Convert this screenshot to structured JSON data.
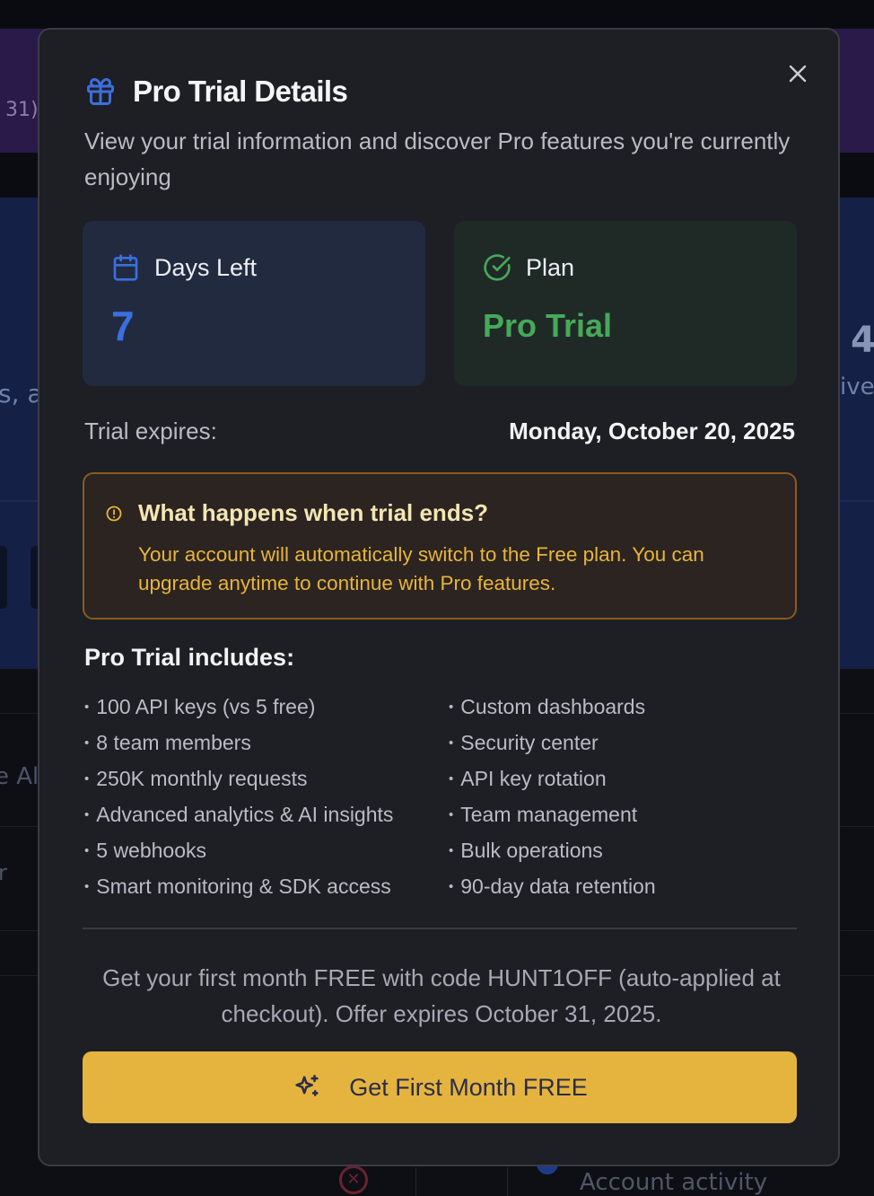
{
  "background": {
    "banner_text": "31)",
    "hero_left_text": "s, a",
    "hero_number": "4",
    "hero_right_text": "ive",
    "lower_text_1": "e Ale",
    "lower_text_2": "r",
    "bottom_text": "Account activity"
  },
  "modal": {
    "title": "Pro Trial Details",
    "subtitle": "View your trial information and discover Pro features you're currently enjoying",
    "days_card": {
      "label": "Days Left",
      "value": "7"
    },
    "plan_card": {
      "label": "Plan",
      "value": "Pro Trial"
    },
    "expires": {
      "label": "Trial expires:",
      "value": "Monday, October 20, 2025"
    },
    "warning": {
      "title": "What happens when trial ends?",
      "text": "Your account will automatically switch to the Free plan. You can upgrade anytime to continue with Pro features."
    },
    "includes": {
      "title": "Pro Trial includes:",
      "left": [
        "100 API keys (vs 5 free)",
        "8 team members",
        "250K monthly requests",
        "Advanced analytics & AI insights",
        "5 webhooks",
        "Smart monitoring & SDK access"
      ],
      "right": [
        "Custom dashboards",
        "Security center",
        "API key rotation",
        "Team management",
        "Bulk operations",
        "90-day data retention"
      ]
    },
    "promo": "Get your first month FREE with code HUNT1OFF (auto-applied at checkout). Offer expires October 31, 2025.",
    "cta_label": "Get First Month FREE"
  },
  "icons": {
    "gift": "gift-icon",
    "calendar": "calendar-icon",
    "check": "check-circle-icon",
    "alert": "alert-circle-icon",
    "sparkles": "sparkles-icon",
    "close": "close-icon"
  },
  "colors": {
    "accent_blue": "#3b6fe0",
    "accent_green": "#47a85a",
    "warning_amber": "#e8b43a",
    "cta_yellow": "#e4b43e"
  }
}
